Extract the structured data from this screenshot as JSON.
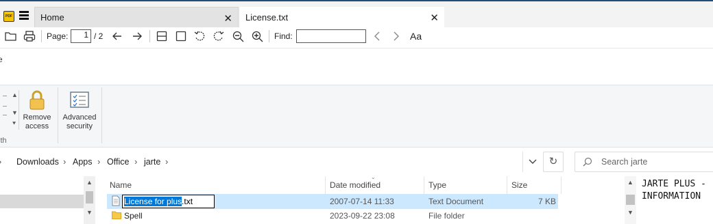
{
  "viewer": {
    "tabs": [
      {
        "label": "Home"
      },
      {
        "label": "License.txt"
      }
    ],
    "toolbar": {
      "page_label": "Page:",
      "page_value": "1",
      "page_total": "/ 2",
      "find_label": "Find:",
      "find_value": "",
      "text_style_glyph": "Aa"
    }
  },
  "explorer": {
    "ribbon": {
      "partial_label_top": "e",
      "partial_label_bottom": "ith",
      "buttons": [
        {
          "label": "Remove access",
          "icon": "lock-icon"
        },
        {
          "label": "Advanced security",
          "icon": "checklist-icon"
        }
      ]
    },
    "breadcrumb": [
      "Downloads",
      "Apps",
      "Office",
      "jarte"
    ],
    "search_placeholder": "Search jarte",
    "columns": [
      "Name",
      "Date modified",
      "Type",
      "Size"
    ],
    "files": [
      {
        "name": "License for plus.txt",
        "name_selected": "License for plus",
        "name_ext": ".txt",
        "date": "2007-07-14 11:33",
        "type": "Text Document",
        "size": "7 KB",
        "icon": "text-file-icon"
      },
      {
        "name": "Spell",
        "date": "2023-09-22 23:08",
        "type": "File folder",
        "size": "",
        "icon": "folder-icon"
      }
    ],
    "preview_lines": [
      "JARTE PLUS -",
      "INFORMATION"
    ]
  },
  "colors": {
    "selection": "#cce8ff",
    "rename_highlight": "#0078d7",
    "accent_line": "#1f4e79"
  }
}
